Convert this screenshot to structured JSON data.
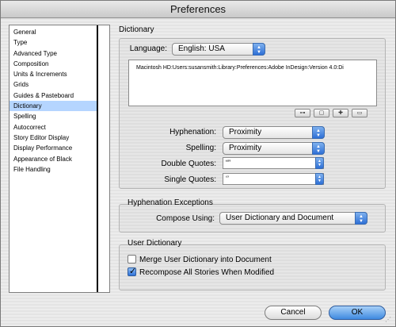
{
  "window": {
    "title": "Preferences"
  },
  "sidebar": {
    "items": [
      {
        "label": "General"
      },
      {
        "label": "Type"
      },
      {
        "label": "Advanced Type"
      },
      {
        "label": "Composition"
      },
      {
        "label": "Units & Increments"
      },
      {
        "label": "Grids"
      },
      {
        "label": "Guides & Pasteboard"
      },
      {
        "label": "Dictionary"
      },
      {
        "label": "Spelling"
      },
      {
        "label": "Autocorrect"
      },
      {
        "label": "Story Editor Display"
      },
      {
        "label": "Display Performance"
      },
      {
        "label": "Appearance of Black"
      },
      {
        "label": "File Handling"
      }
    ],
    "selected": "Dictionary"
  },
  "main": {
    "section_title": "Dictionary",
    "language": {
      "label": "Language:",
      "value": "English: USA"
    },
    "dictionary_path": "Macintosh HD:Users:susansmith:Library:Preferences:Adobe InDesign:Version 4.0:Di",
    "list_buttons": [
      "link-icon",
      "new-icon",
      "add-icon",
      "remove-icon"
    ],
    "hyphenation": {
      "label": "Hyphenation:",
      "value": "Proximity"
    },
    "spelling": {
      "label": "Spelling:",
      "value": "Proximity"
    },
    "double_quotes": {
      "label": "Double Quotes:",
      "value": "“”"
    },
    "single_quotes": {
      "label": "Single Quotes:",
      "value": "‘’"
    },
    "hyphenation_exceptions": {
      "title": "Hyphenation Exceptions",
      "compose_label": "Compose Using:",
      "compose_value": "User Dictionary and Document"
    },
    "user_dictionary": {
      "title": "User Dictionary",
      "merge_label": "Merge User Dictionary into Document",
      "merge_checked": false,
      "recompose_label": "Recompose All Stories When Modified",
      "recompose_checked": true
    }
  },
  "footer": {
    "cancel_label": "Cancel",
    "ok_label": "OK"
  },
  "colors": {
    "accent": "#3f8ae0",
    "selection": "#b5d5ff"
  }
}
